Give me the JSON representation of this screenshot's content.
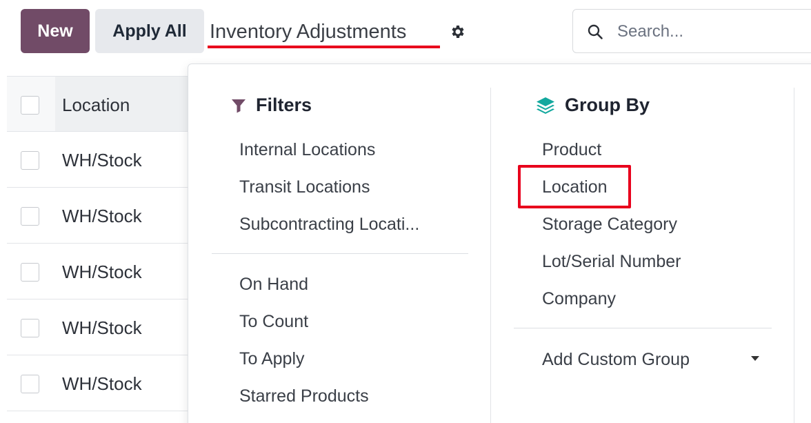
{
  "toolbar": {
    "new_label": "New",
    "apply_all_label": "Apply All",
    "title": "Inventory Adjustments",
    "gear_icon": "gear-icon"
  },
  "search": {
    "placeholder": "Search...",
    "icon": "search-icon"
  },
  "list": {
    "header": "Location",
    "rows": [
      "WH/Stock",
      "WH/Stock",
      "WH/Stock",
      "WH/Stock",
      "WH/Stock"
    ]
  },
  "filters": {
    "title": "Filters",
    "icon": "filter-icon",
    "group1": [
      "Internal Locations",
      "Transit Locations",
      "Subcontracting Locati..."
    ],
    "group2": [
      "On Hand",
      "To Count",
      "To Apply",
      "Starred Products"
    ]
  },
  "group_by": {
    "title": "Group By",
    "icon": "layers-icon",
    "items": [
      "Product",
      "Location",
      "Storage Category",
      "Lot/Serial Number",
      "Company"
    ],
    "add_custom": "Add Custom Group",
    "highlighted": "Location"
  },
  "colors": {
    "primary": "#714b67",
    "annotation": "#e8001c"
  }
}
